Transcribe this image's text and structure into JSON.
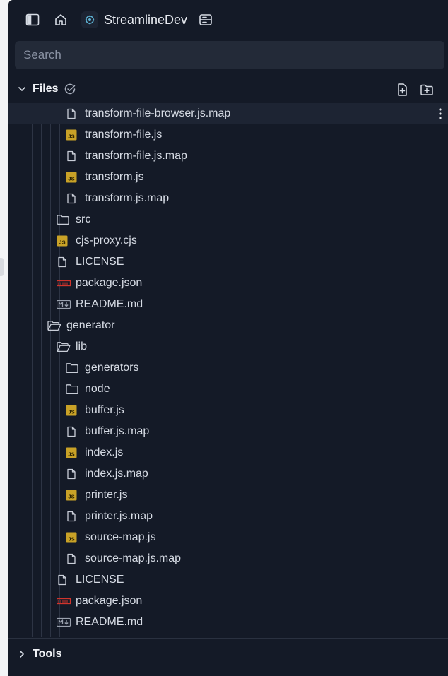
{
  "workspace": {
    "name": "StreamlineDev"
  },
  "search": {
    "placeholder": "Search",
    "value": ""
  },
  "files_section": {
    "title": "Files"
  },
  "tools_section": {
    "title": "Tools"
  },
  "tree": [
    {
      "label": "transform-file-browser.js.map",
      "type": "map",
      "depth": 3,
      "selected": true
    },
    {
      "label": "transform-file.js",
      "type": "js",
      "depth": 3
    },
    {
      "label": "transform-file.js.map",
      "type": "map",
      "depth": 3
    },
    {
      "label": "transform.js",
      "type": "js",
      "depth": 3
    },
    {
      "label": "transform.js.map",
      "type": "map",
      "depth": 3
    },
    {
      "label": "src",
      "type": "folder",
      "depth": 2
    },
    {
      "label": "cjs-proxy.cjs",
      "type": "js",
      "depth": 2
    },
    {
      "label": "LICENSE",
      "type": "file",
      "depth": 2
    },
    {
      "label": "package.json",
      "type": "npm",
      "depth": 2
    },
    {
      "label": "README.md",
      "type": "md",
      "depth": 2
    },
    {
      "label": "generator",
      "type": "folder-open",
      "depth": 1
    },
    {
      "label": "lib",
      "type": "folder-open",
      "depth": 2
    },
    {
      "label": "generators",
      "type": "folder",
      "depth": 3
    },
    {
      "label": "node",
      "type": "folder",
      "depth": 3
    },
    {
      "label": "buffer.js",
      "type": "js",
      "depth": 3
    },
    {
      "label": "buffer.js.map",
      "type": "map",
      "depth": 3
    },
    {
      "label": "index.js",
      "type": "js",
      "depth": 3
    },
    {
      "label": "index.js.map",
      "type": "map",
      "depth": 3
    },
    {
      "label": "printer.js",
      "type": "js",
      "depth": 3
    },
    {
      "label": "printer.js.map",
      "type": "map",
      "depth": 3
    },
    {
      "label": "source-map.js",
      "type": "js",
      "depth": 3
    },
    {
      "label": "source-map.js.map",
      "type": "map",
      "depth": 3
    },
    {
      "label": "LICENSE",
      "type": "file",
      "depth": 2
    },
    {
      "label": "package.json",
      "type": "npm",
      "depth": 2
    },
    {
      "label": "README.md",
      "type": "md",
      "depth": 2
    }
  ],
  "colors": {
    "panel_bg": "#141a27",
    "search_bg": "#232a38",
    "selected_row": "#1d2433",
    "js_badge": "#c9a227",
    "npm_red": "#d0342c",
    "text": "#d6dbe4"
  }
}
